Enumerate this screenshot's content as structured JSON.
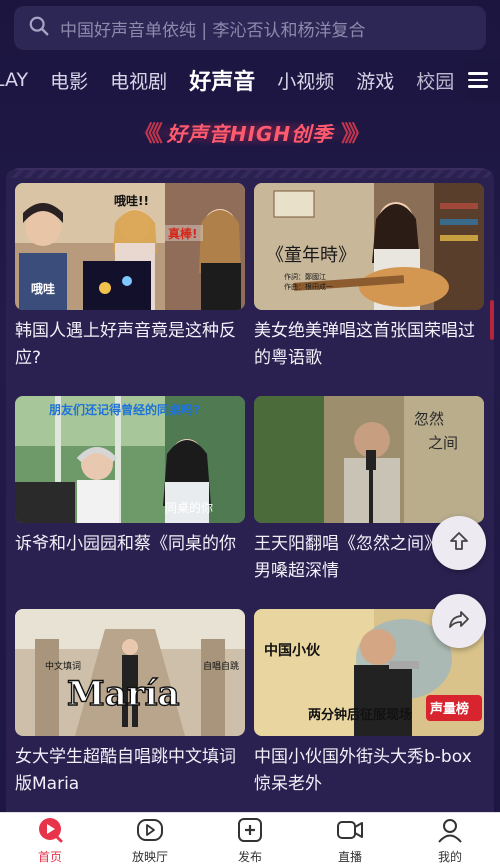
{
  "search": {
    "placeholder": "中国好声音单依纯 | 李沁否认和杨洋复合"
  },
  "tabs": [
    {
      "label": "LAY"
    },
    {
      "label": "电影"
    },
    {
      "label": "电视剧"
    },
    {
      "label": "好声音"
    },
    {
      "label": "小视频"
    },
    {
      "label": "游戏"
    },
    {
      "label": "校园"
    }
  ],
  "banner": {
    "left_chevrons": "《《",
    "title": "好声音HIGH创季",
    "right_chevrons": "》》"
  },
  "videos": [
    {
      "title": "韩国人遇上好声音竟是这种反应?",
      "overlay_1": "哦哇!!",
      "overlay_2": "真棒!",
      "overlay_3": "哦哇"
    },
    {
      "title": "美女绝美弹唱这首张国荣唱过的粤语歌",
      "overlay_1": "《童年時》",
      "overlay_2": "作詞：鄭國江",
      "overlay_3": "作曲：根田成一"
    },
    {
      "title": "诉爷和小园园和蔡《同桌的你",
      "overlay_1": "朋友们还记得曾经的同桌吗?",
      "overlay_2": "同桌的你"
    },
    {
      "title": "王天阳翻唱《忽然之间》，沙哑男嗓超深情",
      "overlay_1": "忽然",
      "overlay_2": "之间"
    },
    {
      "title": "女大学生超酷自唱跳中文填词版Maria",
      "overlay_1": "María",
      "overlay_2": "中文填词",
      "overlay_3": "自唱自跳"
    },
    {
      "title": "中国小伙国外街头大秀b-box惊呆老外",
      "overlay_1": "中国小伙",
      "overlay_2": "两分钟后征服现场",
      "overlay_3": "声量榜"
    }
  ],
  "bottom_nav": [
    {
      "label": "首页",
      "icon": "home-icon"
    },
    {
      "label": "放映厅",
      "icon": "play-icon"
    },
    {
      "label": "发布",
      "icon": "plus-icon"
    },
    {
      "label": "直播",
      "icon": "camera-icon"
    },
    {
      "label": "我的",
      "icon": "person-icon"
    }
  ],
  "colors": {
    "accent": "#e8344b",
    "background": "#1d1640",
    "panel": "#2a2150"
  }
}
